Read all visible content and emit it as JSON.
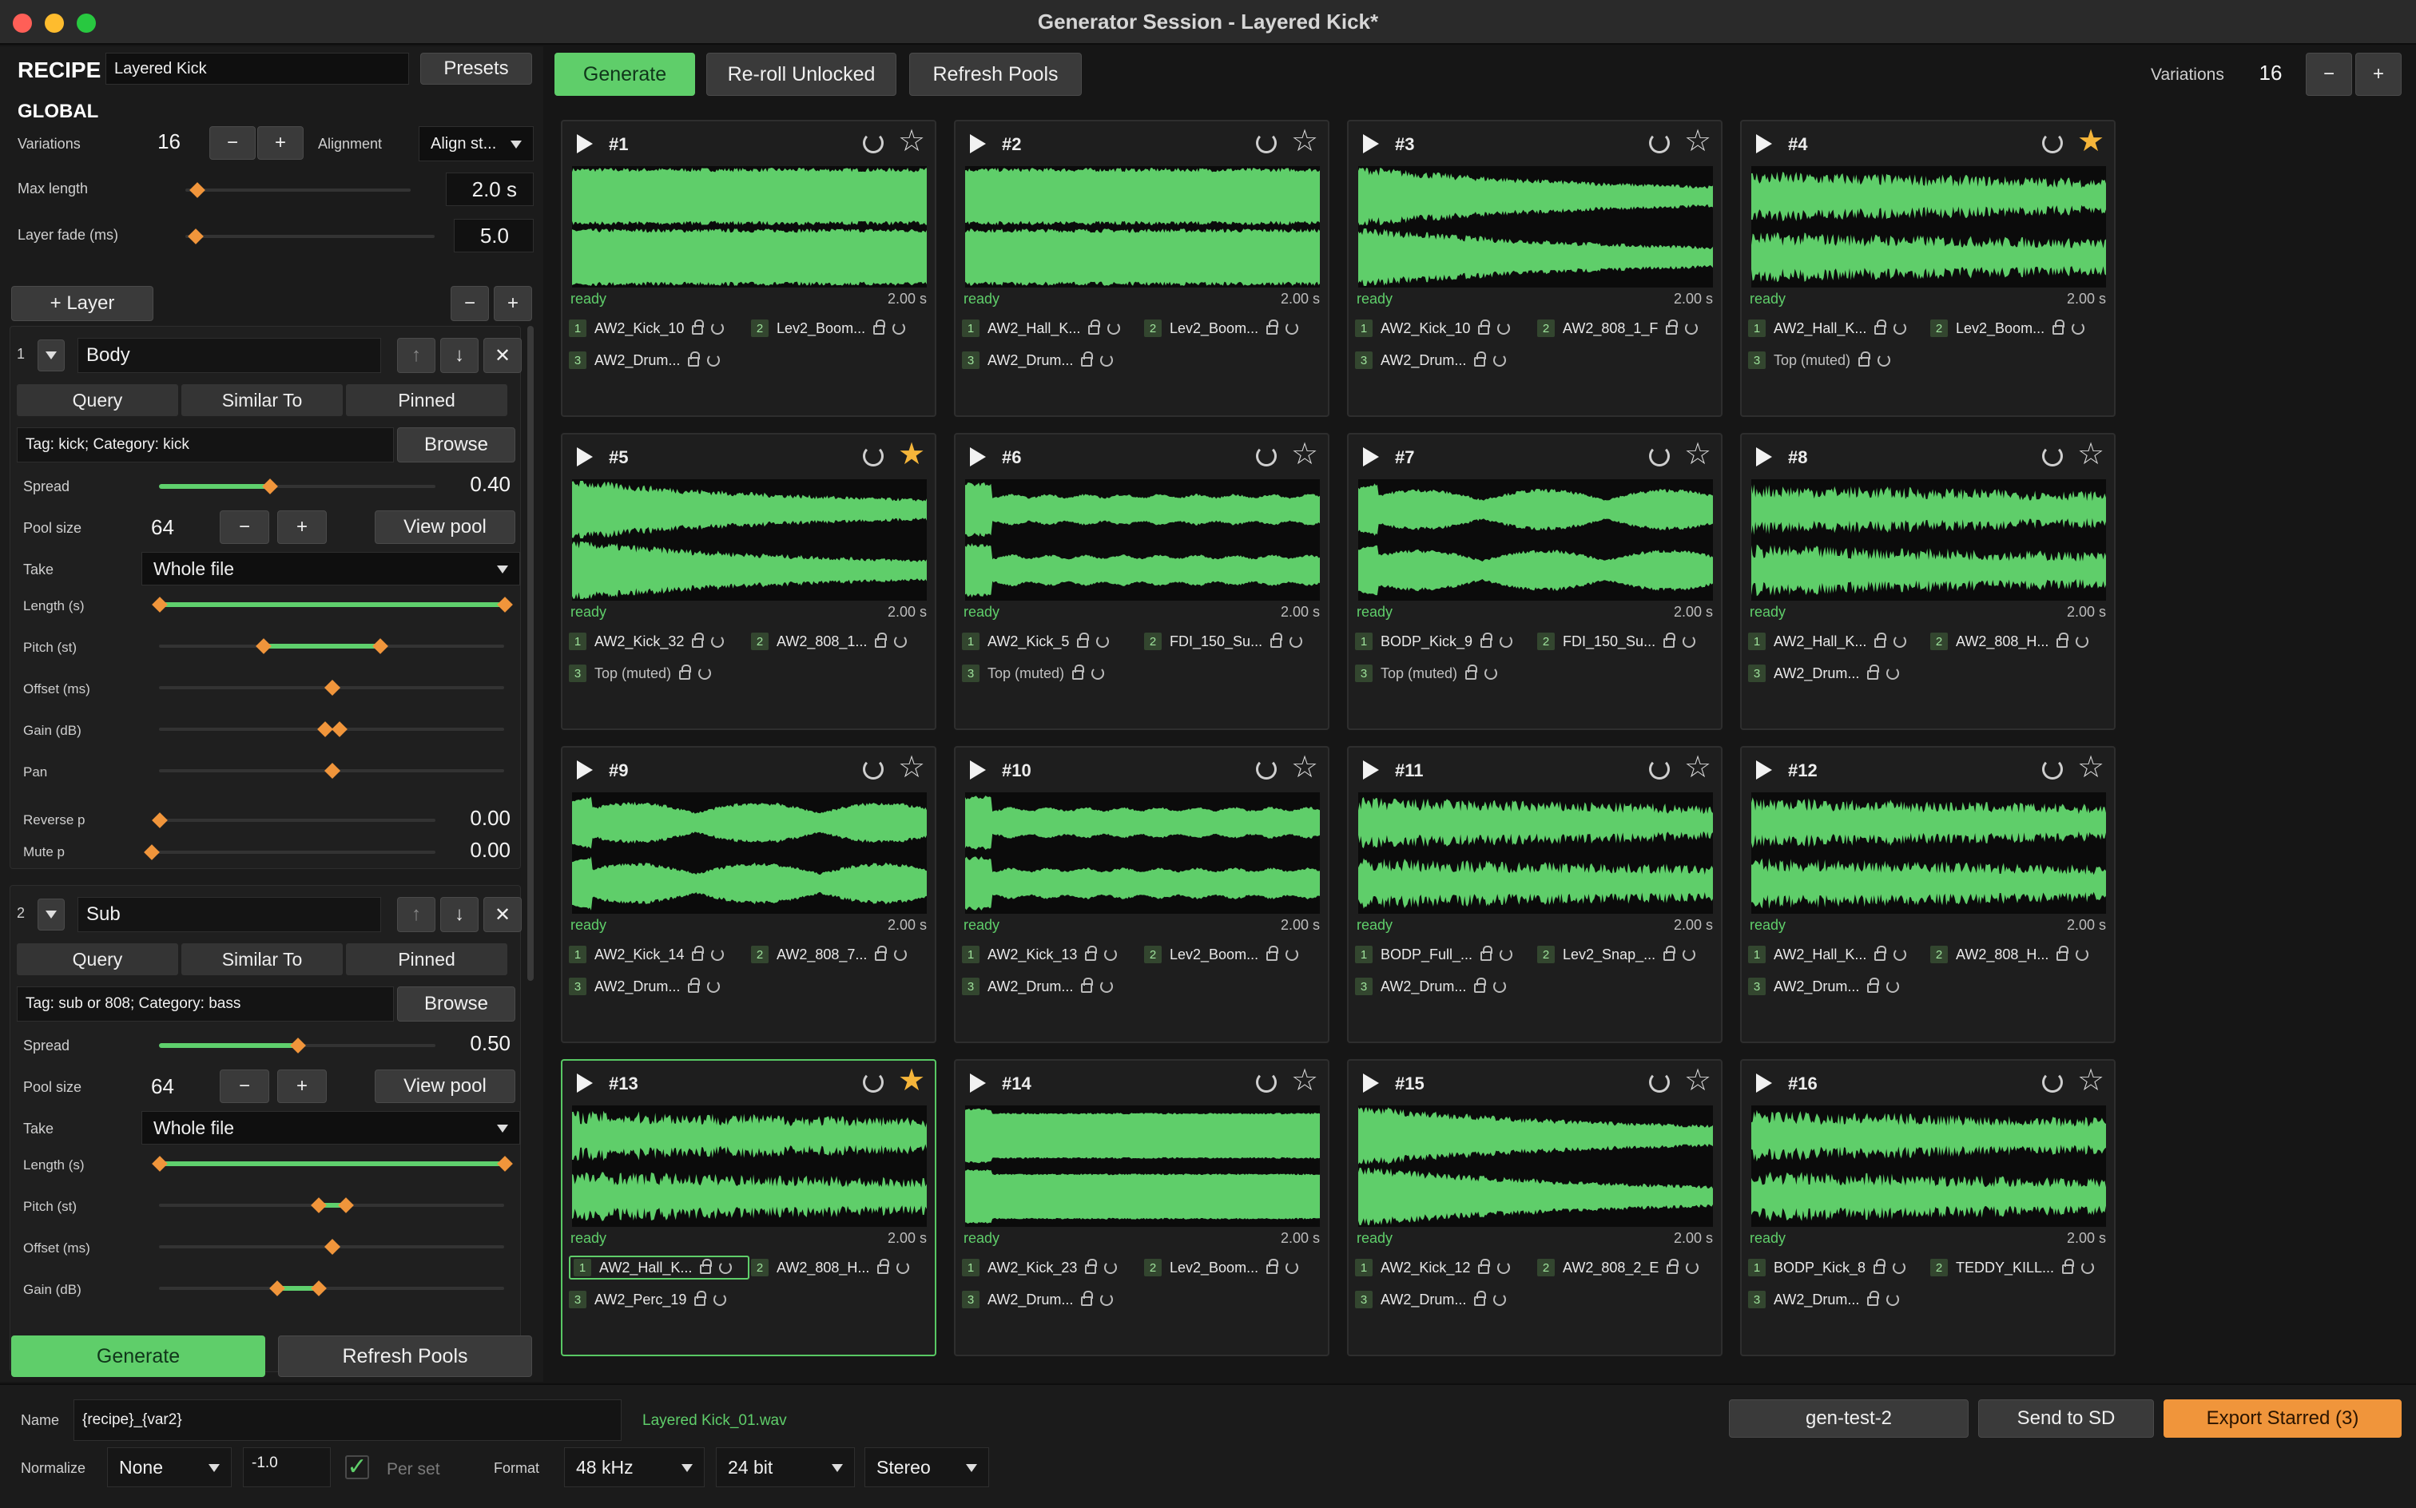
{
  "window": {
    "title": "Generator Session - Layered Kick*",
    "colors": {
      "close": "#ff5f57",
      "minimize": "#febc2e",
      "zoom": "#28c840",
      "accent": "#5fce6a",
      "export": "#f0953b"
    }
  },
  "recipe": {
    "label": "RECIPE",
    "name": "Layered Kick",
    "presets": "Presets"
  },
  "global": {
    "label": "GLOBAL",
    "variations_label": "Variations",
    "variations": "16",
    "minus": "−",
    "plus": "+",
    "alignment_label": "Alignment",
    "alignment": "Align st...",
    "max_length_label": "Max length",
    "max_length": "2.0 s",
    "max_length_pos": 0.04,
    "fade_label": "Layer fade (ms)",
    "fade": "5.0",
    "fade_pos": 0.03
  },
  "layer_controls": {
    "add": "+ Layer",
    "minus": "−",
    "plus": "+"
  },
  "layers": [
    {
      "index": "1",
      "name": "Body",
      "tabs": [
        "Query",
        "Similar To",
        "Pinned"
      ],
      "query": "Tag: kick; Category: kick",
      "browse": "Browse",
      "spread_label": "Spread",
      "spread": "0.40",
      "spread_pos": 0.4,
      "pool_label": "Pool size",
      "pool": "64",
      "view_pool": "View pool",
      "take_label": "Take",
      "take": "Whole file",
      "rows": [
        {
          "label": "Length (s)",
          "lo": 0,
          "hi": 1,
          "range": true
        },
        {
          "label": "Pitch (st)",
          "lo": 0.3,
          "hi": 0.64,
          "range": true
        },
        {
          "label": "Offset (ms)",
          "lo": 0.5,
          "hi": 0.5,
          "range": false
        },
        {
          "label": "Gain (dB)",
          "lo": 0.48,
          "hi": 0.52,
          "range": false
        },
        {
          "label": "Pan",
          "lo": 0.5,
          "hi": 0.5,
          "range": false
        }
      ],
      "reverse_label": "Reverse p",
      "reverse": "0.00",
      "mute_label": "Mute p",
      "mute": "0.00"
    },
    {
      "index": "2",
      "name": "Sub",
      "tabs": [
        "Query",
        "Similar To",
        "Pinned"
      ],
      "query": "Tag: sub or 808; Category: bass",
      "browse": "Browse",
      "spread_label": "Spread",
      "spread": "0.50",
      "spread_pos": 0.5,
      "pool_label": "Pool size",
      "pool": "64",
      "view_pool": "View pool",
      "take_label": "Take",
      "take": "Whole file",
      "rows": [
        {
          "label": "Length (s)",
          "lo": 0,
          "hi": 1,
          "range": true
        },
        {
          "label": "Pitch (st)",
          "lo": 0.46,
          "hi": 0.54,
          "range": true
        },
        {
          "label": "Offset (ms)",
          "lo": 0.5,
          "hi": 0.5,
          "range": false
        },
        {
          "label": "Gain (dB)",
          "lo": 0.34,
          "hi": 0.46,
          "range": true
        }
      ]
    }
  ],
  "left_footer": {
    "generate": "Generate",
    "refresh": "Refresh Pools"
  },
  "toolbar": {
    "generate": "Generate",
    "reroll": "Re-roll Unlocked",
    "refresh": "Refresh Pools",
    "variations_label": "Variations",
    "variations": "16",
    "minus": "−",
    "plus": "+"
  },
  "cards": [
    {
      "num": "#1",
      "starred": false,
      "status": "ready",
      "dur": "2.00 s",
      "style": "dense",
      "slots": [
        "AW2_Kick_10",
        "Lev2_Boom...",
        "AW2_Drum..."
      ]
    },
    {
      "num": "#2",
      "starred": false,
      "status": "ready",
      "dur": "2.00 s",
      "style": "dense",
      "slots": [
        "AW2_Hall_K...",
        "Lev2_Boom...",
        "AW2_Drum..."
      ]
    },
    {
      "num": "#3",
      "starred": false,
      "status": "ready",
      "dur": "2.00 s",
      "style": "decay",
      "slots": [
        "AW2_Kick_10",
        "AW2_808_1_F",
        "AW2_Drum..."
      ]
    },
    {
      "num": "#4",
      "starred": true,
      "status": "ready",
      "dur": "2.00 s",
      "style": "noisy",
      "slots": [
        "AW2_Hall_K...",
        "Lev2_Boom...",
        "Top (muted)"
      ]
    },
    {
      "num": "#5",
      "starred": true,
      "status": "ready",
      "dur": "2.00 s",
      "style": "decay",
      "slots": [
        "AW2_Kick_32",
        "AW2_808_1...",
        "Top (muted)"
      ]
    },
    {
      "num": "#6",
      "starred": false,
      "status": "ready",
      "dur": "2.00 s",
      "style": "flat",
      "slots": [
        "AW2_Kick_5",
        "FDI_150_Su...",
        "Top (muted)"
      ]
    },
    {
      "num": "#7",
      "starred": false,
      "status": "ready",
      "dur": "2.00 s",
      "style": "wobble",
      "slots": [
        "BODP_Kick_9",
        "FDI_150_Su...",
        "Top (muted)"
      ]
    },
    {
      "num": "#8",
      "starred": false,
      "status": "ready",
      "dur": "2.00 s",
      "style": "noisy",
      "slots": [
        "AW2_Hall_K...",
        "AW2_808_H...",
        "AW2_Drum..."
      ]
    },
    {
      "num": "#9",
      "starred": false,
      "status": "ready",
      "dur": "2.00 s",
      "style": "wobble",
      "slots": [
        "AW2_Kick_14",
        "AW2_808_7...",
        "AW2_Drum..."
      ]
    },
    {
      "num": "#10",
      "starred": false,
      "status": "ready",
      "dur": "2.00 s",
      "style": "flat",
      "slots": [
        "AW2_Kick_13",
        "Lev2_Boom...",
        "AW2_Drum..."
      ]
    },
    {
      "num": "#11",
      "starred": false,
      "status": "ready",
      "dur": "2.00 s",
      "style": "noisy",
      "slots": [
        "BODP_Full_...",
        "Lev2_Snap_...",
        "AW2_Drum..."
      ]
    },
    {
      "num": "#12",
      "starred": false,
      "status": "ready",
      "dur": "2.00 s",
      "style": "noisy",
      "slots": [
        "AW2_Hall_K...",
        "AW2_808_H...",
        "AW2_Drum..."
      ]
    },
    {
      "num": "#13",
      "starred": true,
      "status": "ready",
      "dur": "2.00 s",
      "style": "noisy",
      "active": true,
      "slots": [
        "AW2_Hall_K...",
        "AW2_808_H...",
        "AW2_Perc_19"
      ]
    },
    {
      "num": "#14",
      "starred": false,
      "status": "ready",
      "dur": "2.00 s",
      "style": "solid",
      "slots": [
        "AW2_Kick_23",
        "Lev2_Boom...",
        "AW2_Drum..."
      ]
    },
    {
      "num": "#15",
      "starred": false,
      "status": "ready",
      "dur": "2.00 s",
      "style": "decay",
      "slots": [
        "AW2_Kick_12",
        "AW2_808_2_E",
        "AW2_Drum..."
      ]
    },
    {
      "num": "#16",
      "starred": false,
      "status": "ready",
      "dur": "2.00 s",
      "style": "noisy",
      "slots": [
        "BODP_Kick_8",
        "TEDDY_KILL...",
        "AW2_Drum..."
      ]
    }
  ],
  "bottom": {
    "name_label": "Name",
    "name": "{recipe}_{var2}",
    "preview": "Layered Kick_01.wav",
    "normalize_label": "Normalize",
    "normalize": "None",
    "norm_value": "-1.0",
    "per_set": "Per set",
    "format_label": "Format",
    "rate": "48 kHz",
    "bits": "24 bit",
    "channels": "Stereo",
    "target": "gen-test-2",
    "send": "Send to SD",
    "export": "Export Starred (3)"
  }
}
